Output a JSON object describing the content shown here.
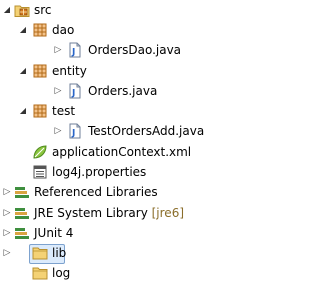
{
  "tree": {
    "src": "src",
    "dao": "dao",
    "orders_dao": "OrdersDao.java",
    "entity": "entity",
    "orders": "Orders.java",
    "test": "test",
    "test_orders_add": "TestOrdersAdd.java",
    "application_context": "applicationContext.xml",
    "log4j": "log4j.properties",
    "referenced_libraries": "Referenced Libraries",
    "jre_library": "JRE System Library",
    "jre_decoration": "[jre6]",
    "junit": "JUnit 4",
    "lib": "lib",
    "log": "log"
  },
  "colors": {
    "selection_fill": "#dcebfc",
    "selection_border": "#7da2ce",
    "package_brown": "#b06a18",
    "folder_yellow": "#f4d275",
    "java_blue": "#2a66c9",
    "library_green": "#3f8f3f"
  }
}
